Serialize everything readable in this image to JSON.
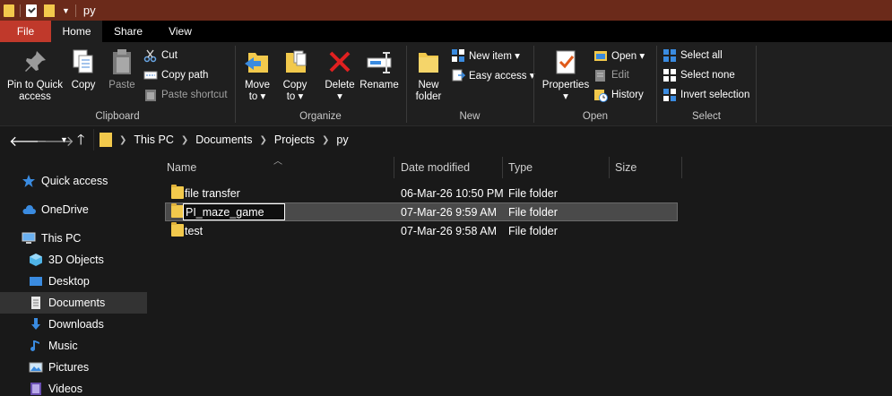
{
  "window": {
    "title": "py"
  },
  "tabs": [
    {
      "label": "File"
    },
    {
      "label": "Home"
    },
    {
      "label": "Share"
    },
    {
      "label": "View"
    }
  ],
  "ribbon": {
    "clipboard": {
      "label": "Clipboard",
      "pin": "Pin to Quick\naccess",
      "pin_line1": "Pin to Quick",
      "pin_line2": "access",
      "copy": "Copy",
      "paste": "Paste",
      "cut": "Cut",
      "copy_path": "Copy path",
      "paste_shortcut": "Paste shortcut"
    },
    "organize": {
      "label": "Organize",
      "move_to_line1": "Move",
      "move_to_line2": "to ▾",
      "copy_to_line1": "Copy",
      "copy_to_line2": "to ▾",
      "delete_line1": "Delete",
      "delete_line2": "▾",
      "rename": "Rename"
    },
    "new": {
      "label": "New",
      "new_folder_line1": "New",
      "new_folder_line2": "folder",
      "new_item": "New item ▾",
      "easy_access": "Easy access ▾"
    },
    "open": {
      "label": "Open",
      "properties_line1": "Properties",
      "properties_line2": "▾",
      "open": "Open ▾",
      "edit": "Edit",
      "history": "History"
    },
    "select": {
      "label": "Select",
      "select_all": "Select all",
      "select_none": "Select none",
      "invert_selection": "Invert selection"
    }
  },
  "address": {
    "crumbs": [
      "This PC",
      "Documents",
      "Projects",
      "py"
    ]
  },
  "nav_pane": {
    "items": [
      {
        "label": "Quick access",
        "icon": "star-icon"
      },
      {
        "label": "OneDrive",
        "icon": "cloud-icon"
      },
      {
        "label": "This PC",
        "icon": "computer-icon"
      },
      {
        "label": "3D Objects",
        "icon": "cube-icon"
      },
      {
        "label": "Desktop",
        "icon": "desktop-icon"
      },
      {
        "label": "Documents",
        "icon": "document-icon"
      },
      {
        "label": "Downloads",
        "icon": "download-icon"
      },
      {
        "label": "Music",
        "icon": "music-icon"
      },
      {
        "label": "Pictures",
        "icon": "pictures-icon"
      },
      {
        "label": "Videos",
        "icon": "videos-icon"
      }
    ]
  },
  "file_list": {
    "columns": {
      "name": "Name",
      "date": "Date modified",
      "type": "Type",
      "size": "Size"
    },
    "rows": [
      {
        "name": "file transfer",
        "date": "06-Mar-26 10:50 PM",
        "type": "File folder"
      },
      {
        "name": "PI_maze_game",
        "date": "07-Mar-26 9:59 AM",
        "type": "File folder"
      },
      {
        "name": "test",
        "date": "07-Mar-26 9:58 AM",
        "type": "File folder"
      }
    ]
  },
  "colors": {
    "title_bar": "#6b2a1a",
    "file_tab": "#c0392b",
    "folder": "#f2c94c",
    "background": "#191919"
  }
}
